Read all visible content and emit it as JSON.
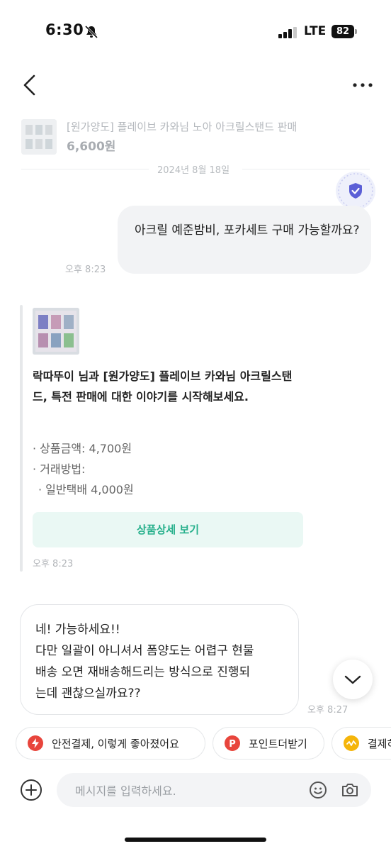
{
  "status_bar": {
    "time": "6:30",
    "network": "LTE",
    "battery": "82"
  },
  "header": {
    "back_icon": "chevron-left-icon",
    "more_icon": "ellipsis-icon"
  },
  "product": {
    "title": "[원가양도] 플레이브 카와님 노아 아크릴스탠드 판매",
    "price": "6,600원"
  },
  "date_divider": "2024년 8월 18일",
  "messages": {
    "sent_1": {
      "text": "아크릴 예준밤비, 포카세트 구매 가능할까요?",
      "time": "오후 8:23"
    },
    "system_card": {
      "text": "락따뚜이 님과 [원가양도] 플레이브 카와님 아크릴스탠드, 특전 판매에 대한 이야기를 시작해보세요.",
      "price_line": "· 상품금액: 4,700원",
      "method_line": "· 거래방법:",
      "method_value": "· 일반택배 4,000원",
      "button_label": "상품상세 보기",
      "time": "오후 8:23"
    },
    "received_1": {
      "text": "네! 가능하세요!!\n다만 일괄이 아니셔서 폼양도는 어렵구 현물\n 배송 오면 재배송해드리는 방식으로 진행되\n는데 괜찮으실까요??",
      "time": "오후 8:27"
    }
  },
  "quick_chips": [
    {
      "label": "안전결제, 이렇게 좋아졌어요",
      "icon": "lightning-icon",
      "color": "#e8453c"
    },
    {
      "label": "포인트더받기",
      "icon": "point-p-icon",
      "color": "#e8453c"
    },
    {
      "label": "결제하기",
      "icon": "pay-icon",
      "color": "#f5b50a"
    }
  ],
  "input": {
    "placeholder": "메시지를 입력하세요."
  },
  "colors": {
    "accent_green": "#27b08c",
    "button_bg": "#eaf8f4",
    "shield": "#5b5fd6"
  }
}
